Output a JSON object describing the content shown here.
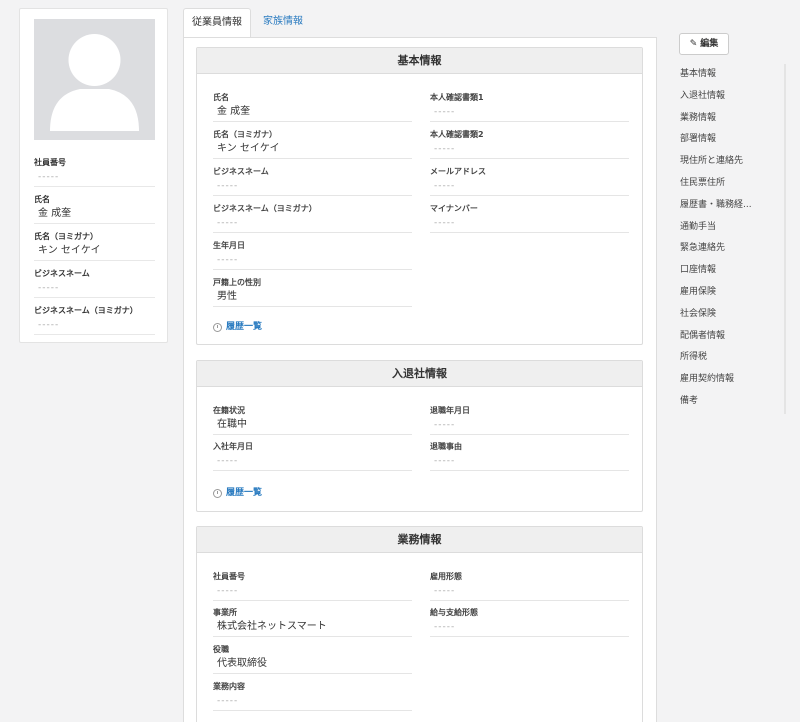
{
  "profile": {
    "fields": [
      {
        "label": "社員番号",
        "value": "-----",
        "empty": true
      },
      {
        "label": "氏名",
        "value": "金 成奎",
        "empty": false
      },
      {
        "label": "氏名（ヨミガナ）",
        "value": "キン セイケイ",
        "empty": false
      },
      {
        "label": "ビジネスネーム",
        "value": "-----",
        "empty": true
      },
      {
        "label": "ビジネスネーム（ヨミガナ）",
        "value": "-----",
        "empty": true
      }
    ]
  },
  "tabs": {
    "employee": "従業員情報",
    "family": "家族情報"
  },
  "sections": {
    "basic": {
      "title": "基本情報",
      "left": [
        {
          "label": "氏名",
          "value": "金 成奎"
        },
        {
          "label": "氏名（ヨミガナ）",
          "value": "キン セイケイ"
        },
        {
          "label": "ビジネスネーム",
          "value": "-----"
        },
        {
          "label": "ビジネスネーム（ヨミガナ）",
          "value": "-----"
        },
        {
          "label": "生年月日",
          "value": "-----"
        },
        {
          "label": "戸籍上の性別",
          "value": "男性"
        }
      ],
      "right": [
        {
          "label": "本人確認書類1",
          "value": "-----"
        },
        {
          "label": "本人確認書類2",
          "value": "-----"
        },
        {
          "label": "メールアドレス",
          "value": "-----"
        },
        {
          "label": "マイナンバー",
          "value": "-----"
        }
      ],
      "history": "履歴一覧"
    },
    "entry": {
      "title": "入退社情報",
      "left": [
        {
          "label": "在籍状況",
          "value": "在職中"
        },
        {
          "label": "入社年月日",
          "value": "-----"
        }
      ],
      "right": [
        {
          "label": "退職年月日",
          "value": "-----"
        },
        {
          "label": "退職事由",
          "value": "-----"
        }
      ],
      "history": "履歴一覧"
    },
    "work": {
      "title": "業務情報",
      "left": [
        {
          "label": "社員番号",
          "value": "-----"
        },
        {
          "label": "事業所",
          "value": "株式会社ネットスマート"
        },
        {
          "label": "役職",
          "value": "代表取締役"
        },
        {
          "label": "業務内容",
          "value": "-----"
        }
      ],
      "right": [
        {
          "label": "雇用形態",
          "value": "-----"
        },
        {
          "label": "給与支給形態",
          "value": "-----"
        }
      ]
    }
  },
  "edit_label": "編集",
  "side_nav": [
    "基本情報",
    "入退社情報",
    "業務情報",
    "部署情報",
    "現住所と連絡先",
    "住民票住所",
    "履歴書・職務経...",
    "通勤手当",
    "緊急連絡先",
    "口座情報",
    "雇用保険",
    "社会保険",
    "配偶者情報",
    "所得税",
    "雇用契約情報",
    "備考"
  ]
}
